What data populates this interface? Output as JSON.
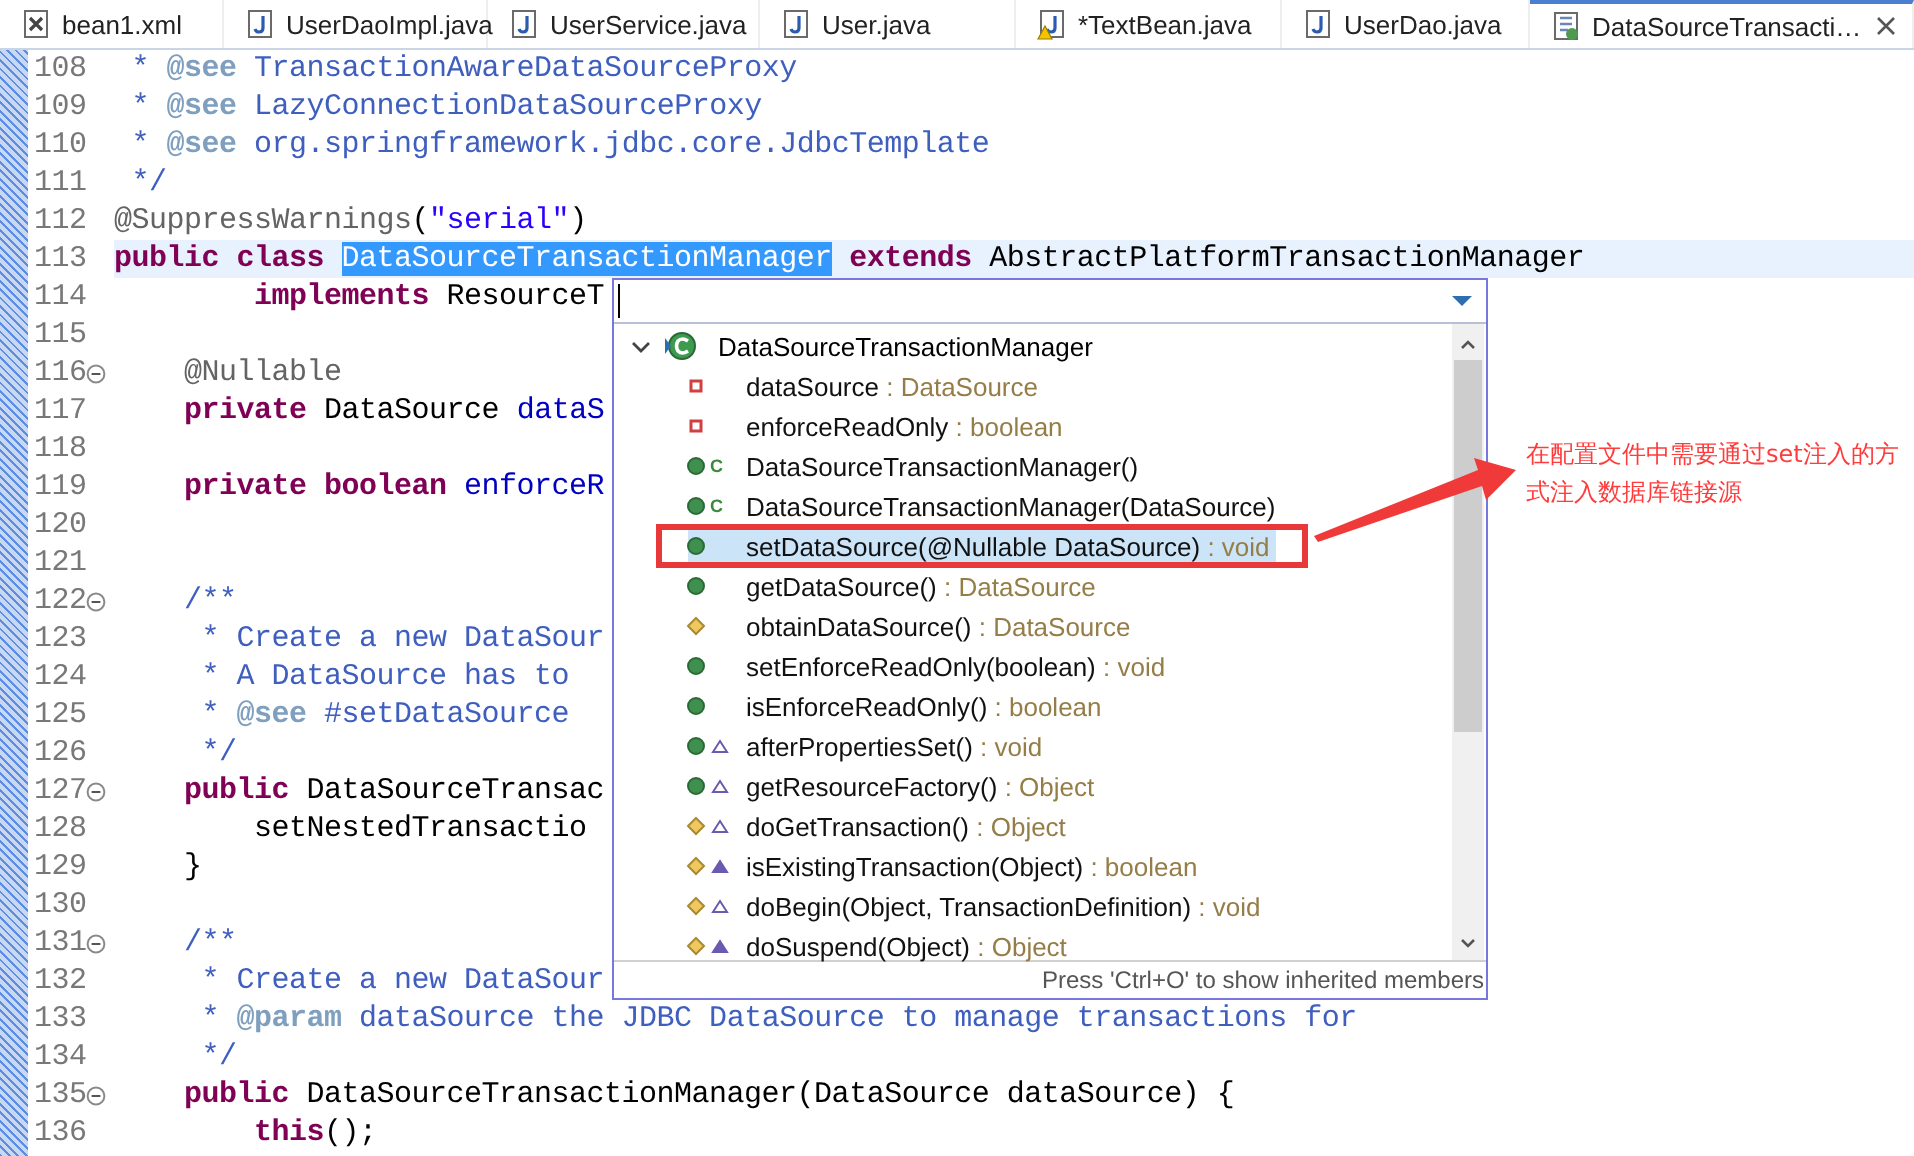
{
  "tabs": [
    {
      "label": "bean1.xml",
      "kind": "xml",
      "selected": false
    },
    {
      "label": "UserDaoImpl.java",
      "kind": "java",
      "selected": false
    },
    {
      "label": "UserService.java",
      "kind": "java",
      "selected": false
    },
    {
      "label": "User.java",
      "kind": "java",
      "selected": false
    },
    {
      "label": "*TextBean.java",
      "kind": "java-warning",
      "selected": false
    },
    {
      "label": "UserDao.java",
      "kind": "java",
      "selected": false
    },
    {
      "label": "DataSourceTransacti…",
      "kind": "class",
      "selected": true
    }
  ],
  "editor": {
    "lines": [
      {
        "number": "108",
        "fold": false,
        "current": false,
        "segments": [
          {
            "kind": "comment",
            "text": " * "
          },
          {
            "kind": "tag",
            "text": "@see"
          },
          {
            "kind": "comment",
            "text": " TransactionAwareDataSourceProxy"
          }
        ]
      },
      {
        "number": "109",
        "fold": false,
        "current": false,
        "segments": [
          {
            "kind": "comment",
            "text": " * "
          },
          {
            "kind": "tag",
            "text": "@see"
          },
          {
            "kind": "comment",
            "text": " LazyConnectionDataSourceProxy"
          }
        ]
      },
      {
        "number": "110",
        "fold": false,
        "current": false,
        "segments": [
          {
            "kind": "comment",
            "text": " * "
          },
          {
            "kind": "tag",
            "text": "@see"
          },
          {
            "kind": "comment",
            "text": " org.springframework.jdbc.core.JdbcTemplate"
          }
        ]
      },
      {
        "number": "111",
        "fold": false,
        "current": false,
        "segments": [
          {
            "kind": "comment",
            "text": " */"
          }
        ]
      },
      {
        "number": "112",
        "fold": false,
        "current": false,
        "segments": [
          {
            "kind": "annotation",
            "text": "@SuppressWarnings"
          },
          {
            "kind": "plain",
            "text": "("
          },
          {
            "kind": "string",
            "text": "\"serial\""
          },
          {
            "kind": "plain",
            "text": ")"
          }
        ]
      },
      {
        "number": "113",
        "fold": false,
        "current": true,
        "segments": [
          {
            "kind": "keyword",
            "text": "public class "
          },
          {
            "kind": "selection",
            "text": "DataSourceTransactionManager"
          },
          {
            "kind": "keyword",
            "text": " extends"
          },
          {
            "kind": "plain",
            "text": " AbstractPlatformTransactionManager"
          }
        ]
      },
      {
        "number": "114",
        "fold": false,
        "current": false,
        "segments": [
          {
            "kind": "keyword",
            "text": "        implements"
          },
          {
            "kind": "plain",
            "text": " ResourceT"
          }
        ]
      },
      {
        "number": "115",
        "fold": false,
        "current": false
      },
      {
        "number": "116",
        "fold": true,
        "current": false,
        "segments": [
          {
            "kind": "annotation",
            "text": "    @Nullable"
          }
        ]
      },
      {
        "number": "117",
        "fold": false,
        "current": false,
        "segments": [
          {
            "kind": "keyword",
            "text": "    private"
          },
          {
            "kind": "plain",
            "text": " DataSource "
          },
          {
            "kind": "field",
            "text": "dataS"
          }
        ]
      },
      {
        "number": "118",
        "fold": false,
        "current": false
      },
      {
        "number": "119",
        "fold": false,
        "current": false,
        "segments": [
          {
            "kind": "keyword",
            "text": "    private boolean "
          },
          {
            "kind": "field",
            "text": "enforceR"
          }
        ]
      },
      {
        "number": "120",
        "fold": false,
        "current": false
      },
      {
        "number": "121",
        "fold": false,
        "current": false
      },
      {
        "number": "122",
        "fold": true,
        "current": false,
        "segments": [
          {
            "kind": "comment",
            "text": "    /**"
          }
        ]
      },
      {
        "number": "123",
        "fold": false,
        "current": false,
        "segments": [
          {
            "kind": "comment",
            "text": "     * Create a new DataSour"
          }
        ]
      },
      {
        "number": "124",
        "fold": false,
        "current": false,
        "segments": [
          {
            "kind": "comment",
            "text": "     * A DataSource has to"
          }
        ]
      },
      {
        "number": "125",
        "fold": false,
        "current": false,
        "segments": [
          {
            "kind": "comment",
            "text": "     * "
          },
          {
            "kind": "tag",
            "text": "@see"
          },
          {
            "kind": "comment",
            "text": " #setDataSource"
          }
        ]
      },
      {
        "number": "126",
        "fold": false,
        "current": false,
        "segments": [
          {
            "kind": "comment",
            "text": "     */"
          }
        ]
      },
      {
        "number": "127",
        "fold": true,
        "current": false,
        "segments": [
          {
            "kind": "keyword",
            "text": "    public"
          },
          {
            "kind": "plain",
            "text": " DataSourceTransac"
          }
        ]
      },
      {
        "number": "128",
        "fold": false,
        "current": false,
        "segments": [
          {
            "kind": "plain",
            "text": "        setNestedTransactio"
          }
        ]
      },
      {
        "number": "129",
        "fold": false,
        "current": false,
        "segments": [
          {
            "kind": "plain",
            "text": "    }"
          }
        ]
      },
      {
        "number": "130",
        "fold": false,
        "current": false
      },
      {
        "number": "131",
        "fold": true,
        "current": false,
        "segments": [
          {
            "kind": "comment",
            "text": "    /**"
          }
        ]
      },
      {
        "number": "132",
        "fold": false,
        "current": false,
        "segments": [
          {
            "kind": "comment",
            "text": "     * Create a new DataSour"
          }
        ]
      },
      {
        "number": "133",
        "fold": false,
        "current": false,
        "segments": [
          {
            "kind": "comment",
            "text": "     * "
          },
          {
            "kind": "tag",
            "text": "@param"
          },
          {
            "kind": "comment",
            "text": " dataSource the JDBC DataSource to manage transactions for"
          }
        ]
      },
      {
        "number": "134",
        "fold": false,
        "current": false,
        "segments": [
          {
            "kind": "comment",
            "text": "     */"
          }
        ]
      },
      {
        "number": "135",
        "fold": true,
        "current": false,
        "segments": [
          {
            "kind": "keyword",
            "text": "    public"
          },
          {
            "kind": "plain",
            "text": " DataSourceTransactionManager(DataSource dataSource) {"
          }
        ]
      },
      {
        "number": "136",
        "fold": false,
        "current": false,
        "segments": [
          {
            "kind": "keyword",
            "text": "        this"
          },
          {
            "kind": "plain",
            "text": "();"
          }
        ]
      }
    ]
  },
  "outline_popup": {
    "header": {
      "label": "DataSourceTransactionManager",
      "expanded": true
    },
    "items": [
      {
        "kind": "field",
        "overrides": false,
        "implements": false,
        "name": "dataSource",
        "type": ": DataSource",
        "selected": false,
        "marked": false
      },
      {
        "kind": "field",
        "overrides": false,
        "implements": false,
        "name": "enforceReadOnly",
        "type": ": boolean",
        "selected": false,
        "marked": false
      },
      {
        "kind": "constructor",
        "badge": "C",
        "overrides": false,
        "implements": false,
        "name": "DataSourceTransactionManager()",
        "selected": false,
        "marked": false
      },
      {
        "kind": "constructor",
        "badge": "C",
        "overrides": false,
        "implements": false,
        "name": "DataSourceTransactionManager(DataSource)",
        "selected": false,
        "marked": false
      },
      {
        "kind": "public",
        "overrides": false,
        "implements": false,
        "name": "setDataSource(@Nullable DataSource)",
        "type": ": void",
        "selected": true,
        "marked": true
      },
      {
        "kind": "public",
        "overrides": false,
        "implements": false,
        "name": "getDataSource()",
        "type": ": DataSource",
        "selected": false,
        "marked": false
      },
      {
        "kind": "protected",
        "overrides": false,
        "implements": false,
        "name": "obtainDataSource()",
        "type": ": DataSource",
        "selected": false,
        "marked": false
      },
      {
        "kind": "public",
        "overrides": false,
        "implements": false,
        "name": "setEnforceReadOnly(boolean)",
        "type": ": void",
        "selected": false,
        "marked": false
      },
      {
        "kind": "public",
        "overrides": false,
        "implements": false,
        "name": "isEnforceReadOnly()",
        "type": ": boolean",
        "selected": false,
        "marked": false
      },
      {
        "kind": "public",
        "overrides": true,
        "implements": false,
        "name": "afterPropertiesSet()",
        "type": ": void",
        "selected": false,
        "marked": false
      },
      {
        "kind": "public",
        "overrides": true,
        "implements": false,
        "name": "getResourceFactory()",
        "type": ": Object",
        "selected": false,
        "marked": false
      },
      {
        "kind": "protected",
        "overrides": true,
        "implements": false,
        "name": "doGetTransaction()",
        "type": ": Object",
        "selected": false,
        "marked": false
      },
      {
        "kind": "protected",
        "overrides": false,
        "implements": true,
        "name": "isExistingTransaction(Object)",
        "type": ": boolean",
        "selected": false,
        "marked": false
      },
      {
        "kind": "protected",
        "overrides": true,
        "implements": false,
        "name": "doBegin(Object, TransactionDefinition)",
        "type": ": void",
        "selected": false,
        "marked": false
      },
      {
        "kind": "protected",
        "overrides": false,
        "implements": true,
        "name": "doSuspend(Object)",
        "type": ": Object",
        "selected": false,
        "marked": false
      }
    ],
    "footer": "Press 'Ctrl+O' to show inherited members"
  },
  "callout": {
    "text": "在配置文件中需要通过set注入的方式注入数据库链接源"
  }
}
